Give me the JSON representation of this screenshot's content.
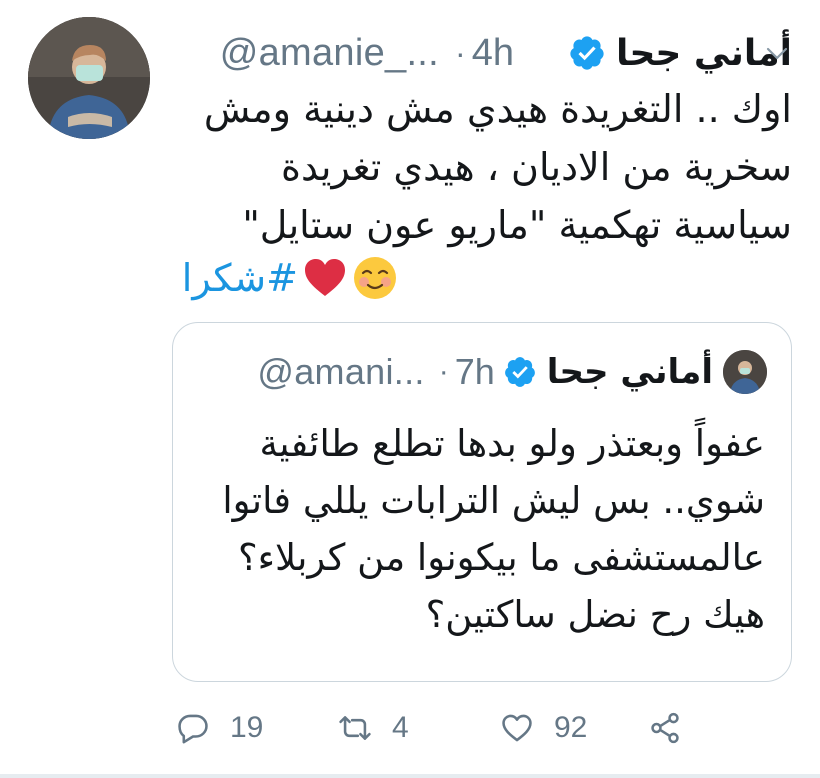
{
  "tweet": {
    "author": {
      "name": "أماني جحا",
      "handle": "@amanie_...",
      "verified": true
    },
    "time": "4h",
    "text_lines": [
      "اوك .. التغريدة هيدي مش دينية ومش",
      "سخرية من الاديان ، هيدي تغريدة",
      "سياسية تهكمية \"ماريو عون ستايل\""
    ],
    "hashtag": "#شكرا",
    "emojis": [
      "smiling-face-icon",
      "red-heart-icon"
    ],
    "menu_icon": "chevron-down-icon"
  },
  "quoted_tweet": {
    "author": {
      "name": "أماني جحا",
      "handle": "@amani...",
      "verified": true
    },
    "time": "7h",
    "text_lines": [
      "عفواً وبعتذر ولو بدها تطلع طائفية",
      "شوي.. بس ليش الترابات يللي فاتوا",
      "عالمستشفى ما بيكونوا من كربلاء؟",
      "هيك رح نضل ساكتين؟"
    ]
  },
  "actions": {
    "reply_count": "19",
    "retweet_count": "4",
    "like_count": "92"
  },
  "colors": {
    "accent": "#1b95e0",
    "verified": "#1da1f2",
    "muted": "#657786",
    "heart": "#e0245e",
    "border": "#ccd6dd"
  }
}
